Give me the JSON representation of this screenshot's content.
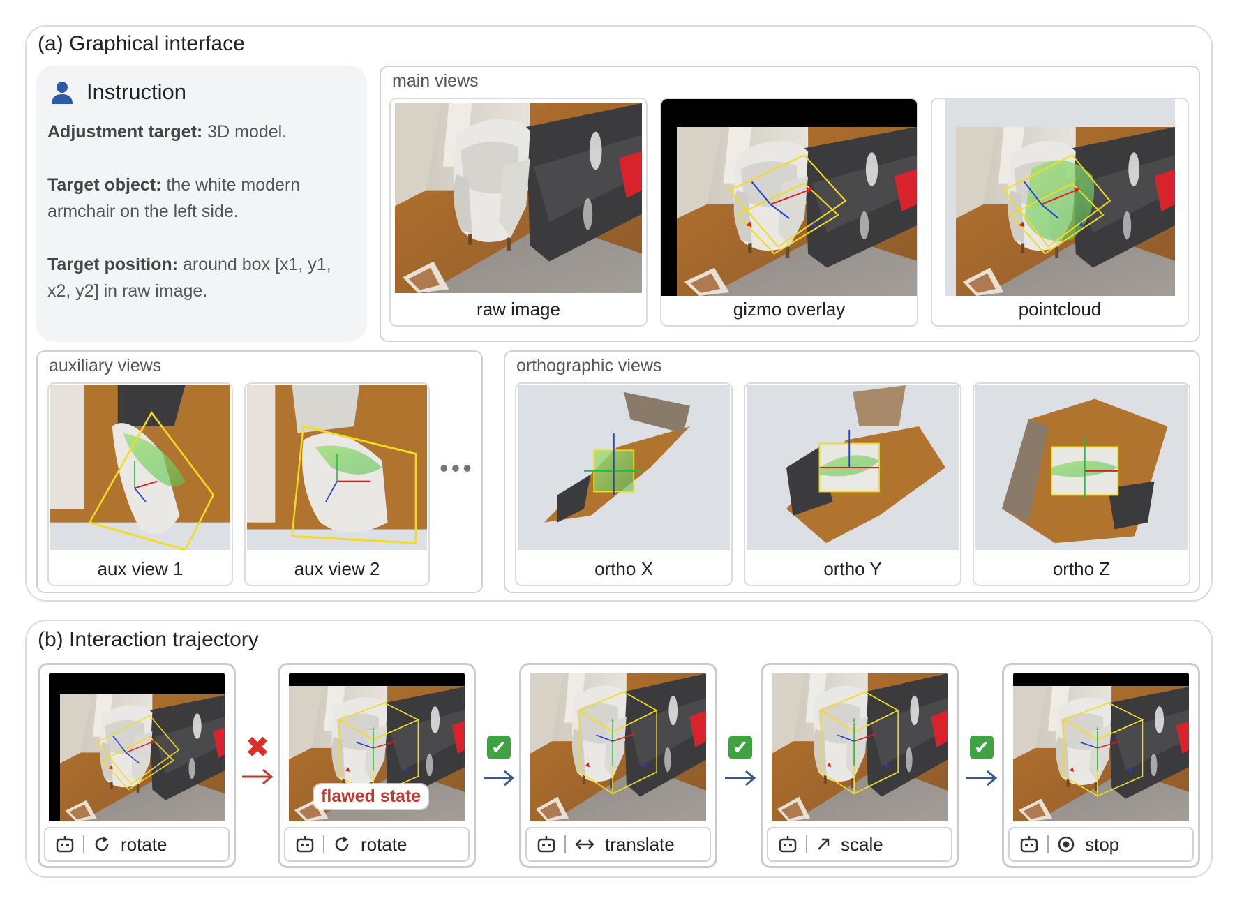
{
  "section_a": {
    "title": "(a) Graphical interface",
    "instruction": {
      "heading": "Instruction",
      "target_label": "Adjustment target:",
      "target_value": " 3D model.",
      "object_label": "Target object:",
      "object_value": " the white modern armchair on the left side.",
      "position_label": "Target position:",
      "position_value": " around box [x1, y1, x2, y2] in raw image."
    },
    "main_views": {
      "title": "main views",
      "items": [
        {
          "caption": "raw image"
        },
        {
          "caption": "gizmo overlay"
        },
        {
          "caption": "pointcloud"
        }
      ]
    },
    "auxiliary_views": {
      "title": "auxiliary views",
      "items": [
        {
          "caption": "aux view 1"
        },
        {
          "caption": "aux view 2"
        }
      ],
      "more": "•••"
    },
    "orthographic_views": {
      "title": "orthographic views",
      "items": [
        {
          "caption": "ortho X"
        },
        {
          "caption": "ortho Y"
        },
        {
          "caption": "ortho Z"
        }
      ]
    }
  },
  "section_b": {
    "title": "(b) Interaction trajectory",
    "flawed_label": "flawed state",
    "steps": [
      {
        "action": "rotate",
        "icon": "rotate-icon"
      },
      {
        "action": "rotate",
        "icon": "rotate-icon"
      },
      {
        "action": "translate",
        "icon": "translate-icon"
      },
      {
        "action": "scale",
        "icon": "scale-icon"
      },
      {
        "action": "stop",
        "icon": "stop-icon"
      }
    ],
    "transitions": [
      {
        "status": "rejected",
        "mark": "✖",
        "color": "#d9302c"
      },
      {
        "status": "accepted",
        "mark": "✔",
        "color": "#3a5a8c"
      },
      {
        "status": "accepted",
        "mark": "✔",
        "color": "#3a5a8c"
      },
      {
        "status": "accepted",
        "mark": "✔",
        "color": "#3a5a8c"
      }
    ]
  },
  "colors": {
    "bbox_yellow": "#f2dc1f",
    "axis_red": "#e02020",
    "axis_green": "#2bb84a",
    "axis_blue": "#2040e0",
    "accent_blue": "#2d5aa8"
  }
}
